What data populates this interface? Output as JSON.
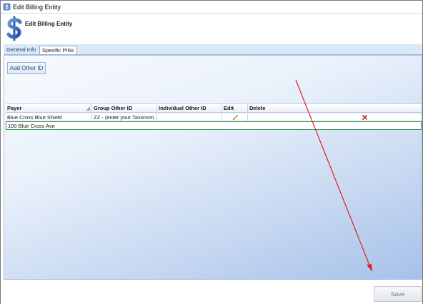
{
  "window": {
    "title": "Edit Billing Entity",
    "app_icon": "dollar-app-icon"
  },
  "header": {
    "title": "Edit Billing Entity",
    "icon": "dollar-sign-icon"
  },
  "tabs": [
    {
      "label": "General Info",
      "selected": false
    },
    {
      "label": "Specific PINs",
      "selected": true
    }
  ],
  "toolbar": {
    "add_other_id_label": "Add Other ID"
  },
  "grid": {
    "columns": [
      "Payer",
      "Group Other ID",
      "Individual Other ID",
      "Edit",
      "Delete"
    ],
    "rows": [
      {
        "payer": "Blue Cross Blue Shield",
        "group_other_id": "ZZ - (enter your Taxonom...",
        "individual_other_id": "",
        "edit_icon": "pencil-icon",
        "delete_icon": "red-x-icon"
      }
    ],
    "detail_row": {
      "text": "100 Blue Cross Ave"
    }
  },
  "footer": {
    "save_label": "Save"
  },
  "colors": {
    "annotation_arrow": "#e0201c",
    "delete_icon": "#d61f1f",
    "detail_border": "#2e9c5c"
  }
}
